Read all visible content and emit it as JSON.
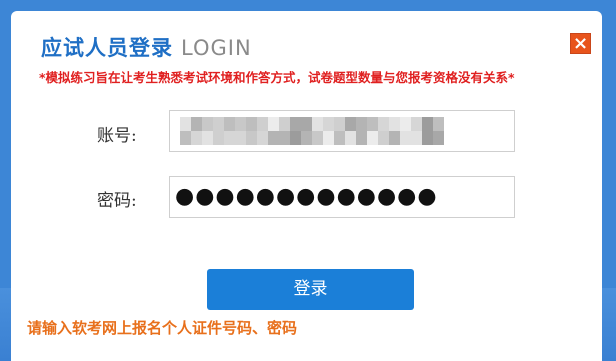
{
  "dialog": {
    "title_cn": "应试人员登录",
    "title_en": "LOGIN",
    "close_glyph": "×",
    "notice": "*模拟练习旨在让考生熟悉考试环境和作答方式，试卷题型数量与您报考资格没有关系*"
  },
  "form": {
    "account_label": "账号:",
    "password_label": "密码:",
    "password_masked": "●●●●●●●●●●●●●"
  },
  "actions": {
    "login_label": "登录"
  },
  "hint": "请输入软考网上报名个人证件号码、密码",
  "colors": {
    "title_blue": "#1f6fc5",
    "notice_red": "#e02020",
    "button_blue": "#1b7fd8",
    "close_orange": "#e8541c",
    "hint_orange": "#e8701c"
  },
  "icons": {
    "close": "close-icon"
  }
}
